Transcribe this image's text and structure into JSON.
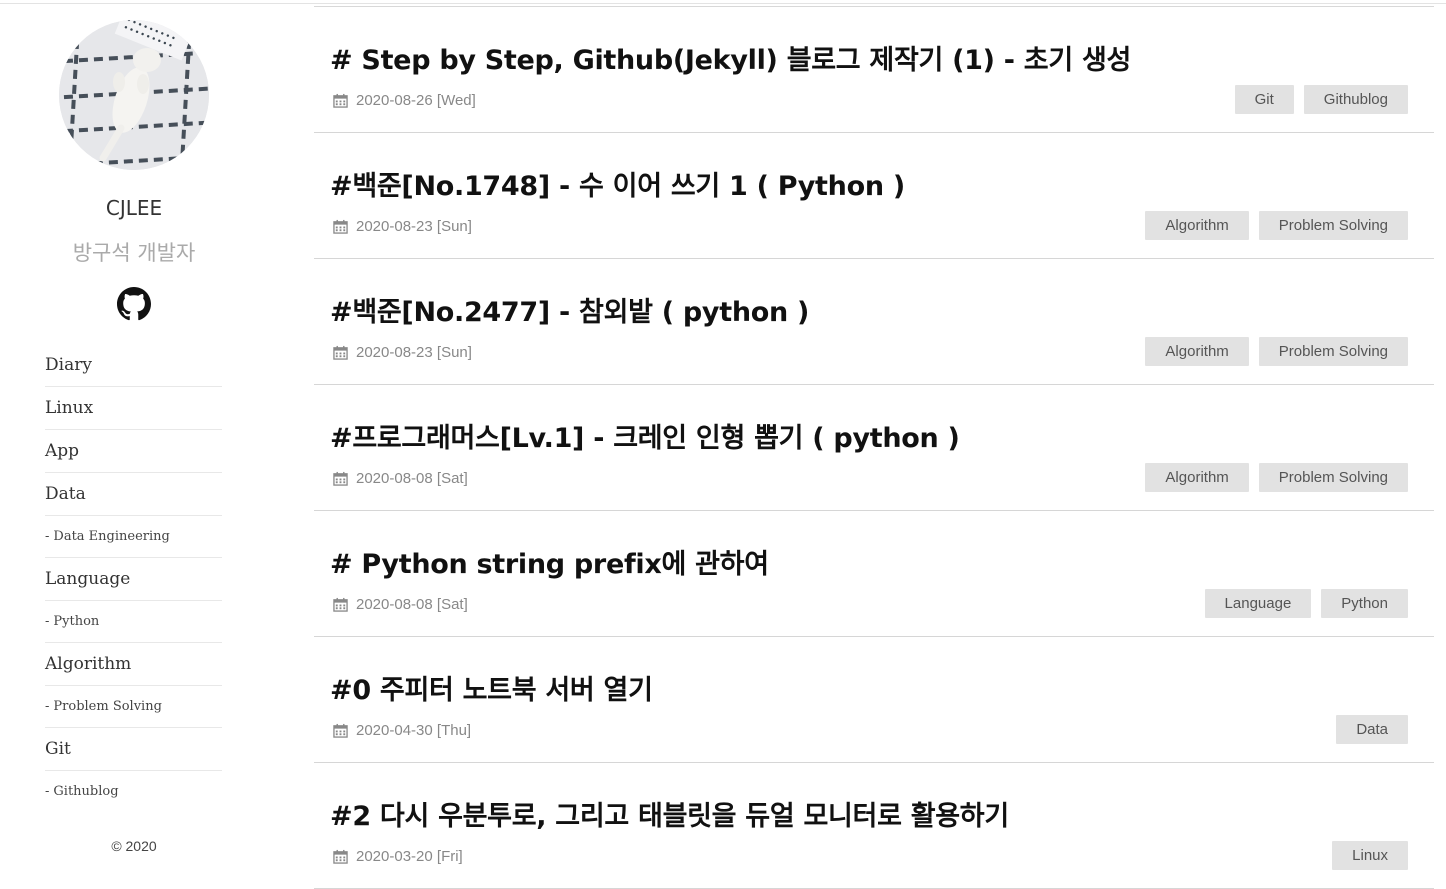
{
  "author": {
    "name": "CJLEE",
    "subtitle": "방구석 개발자",
    "avatar_icon": "cat-photo-avatar",
    "github_icon": "github-icon"
  },
  "nav": {
    "items": [
      {
        "label": "Diary",
        "level": "main"
      },
      {
        "label": "Linux",
        "level": "main"
      },
      {
        "label": "App",
        "level": "main"
      },
      {
        "label": "Data",
        "level": "main"
      },
      {
        "label": "Data Engineering",
        "level": "sub"
      },
      {
        "label": "Language",
        "level": "main"
      },
      {
        "label": "Python",
        "level": "sub"
      },
      {
        "label": "Algorithm",
        "level": "main"
      },
      {
        "label": "Problem Solving",
        "level": "sub"
      },
      {
        "label": "Git",
        "level": "main"
      },
      {
        "label": "Githublog",
        "level": "sub"
      }
    ],
    "sub_prefix": "-"
  },
  "footer": {
    "copyright": "© 2020"
  },
  "posts": [
    {
      "title": "# Step by Step, Github(Jekyll) 블로그 제작기 (1) - 초기 생성",
      "date": "2020-08-26 [Wed]",
      "tags": [
        "Git",
        "Githublog"
      ]
    },
    {
      "title": "#백준[No.1748] - 수 이어 쓰기 1 ( Python )",
      "date": "2020-08-23 [Sun]",
      "tags": [
        "Algorithm",
        "Problem Solving"
      ]
    },
    {
      "title": "#백준[No.2477] - 참외밭 ( python )",
      "date": "2020-08-23 [Sun]",
      "tags": [
        "Algorithm",
        "Problem Solving"
      ]
    },
    {
      "title": "#프로그래머스[Lv.1] - 크레인 인형 뽑기 ( python )",
      "date": "2020-08-08 [Sat]",
      "tags": [
        "Algorithm",
        "Problem Solving"
      ]
    },
    {
      "title": "# Python string prefix에 관하여",
      "date": "2020-08-08 [Sat]",
      "tags": [
        "Language",
        "Python"
      ]
    },
    {
      "title": "#0 주피터 노트북 서버 열기",
      "date": "2020-04-30 [Thu]",
      "tags": [
        "Data"
      ]
    },
    {
      "title": "#2 다시 우분투로, 그리고 태블릿을 듀얼 모니터로 활용하기",
      "date": "2020-03-20 [Fri]",
      "tags": [
        "Linux"
      ]
    }
  ],
  "meta_icon": "calendar-icon"
}
